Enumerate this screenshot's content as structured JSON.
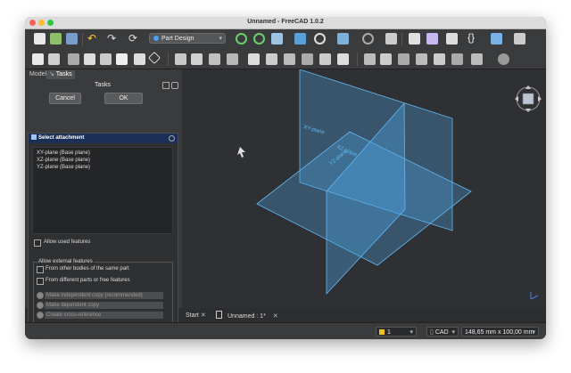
{
  "window": {
    "title": "Unnamed - FreeCAD 1.0.2"
  },
  "toolbar": {
    "workbench": "Part Design"
  },
  "combo_view": {
    "tabs": [
      {
        "label": "Model"
      },
      {
        "label": "Tasks"
      }
    ],
    "tasks_title": "Tasks",
    "cancel_label": "Cancel",
    "ok_label": "OK"
  },
  "attachment_panel": {
    "title": "Select attachment",
    "items": [
      "XY-plane (Base plane)",
      "XZ-plane (Base plane)",
      "YZ-plane (Base plane)"
    ],
    "allow_used_features": "Allow used features",
    "external_title": "Allow external features",
    "from_same_part": "From other bodies of the same part",
    "from_different_parts": "From different parts or free features",
    "options": [
      "Make independent copy (recommended)",
      "Make dependent copy",
      "Create cross-reference"
    ]
  },
  "viewport": {
    "plane_labels": [
      "XY-plane",
      "XZ-plane",
      "YZ-plane"
    ],
    "plane_color": "#4da6e6"
  },
  "document_tabs": [
    {
      "label": "Start"
    },
    {
      "label": "Unnamed : 1*"
    }
  ],
  "status_bar": {
    "page": "1",
    "nav_style": "CAD",
    "dimensions": "148,65 mm x 100,00 mm"
  }
}
